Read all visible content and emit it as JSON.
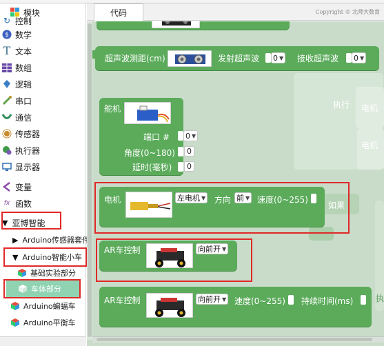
{
  "window": {
    "cut_title": "…"
  },
  "tabs": [
    {
      "label": "代码"
    }
  ],
  "copyright": "Copyright © 北师大数育",
  "sidebar": {
    "top_item": "模块",
    "categories": [
      {
        "label": "控制",
        "icon": "repeat-icon"
      },
      {
        "label": "数学",
        "icon": "math-icon"
      },
      {
        "label": "文本",
        "icon": "text-icon"
      },
      {
        "label": "数组",
        "icon": "array-icon"
      },
      {
        "label": "逻辑",
        "icon": "logic-icon"
      },
      {
        "label": "串口",
        "icon": "serial-icon"
      },
      {
        "label": "通信",
        "icon": "communication-icon"
      },
      {
        "label": "传感器",
        "icon": "sensor-icon"
      },
      {
        "label": "执行器",
        "icon": "actuator-icon"
      },
      {
        "label": "显示器",
        "icon": "display-icon"
      },
      {
        "label": "变量",
        "icon": "variable-icon"
      },
      {
        "label": "函数",
        "icon": "function-icon"
      }
    ],
    "group": "亚博智能",
    "subgroups": [
      {
        "label": "Arduino传感器套件",
        "expanded": false
      },
      {
        "label": "Arduino智能小车",
        "expanded": true
      }
    ],
    "kit_items": [
      {
        "label": "基础实验部分",
        "selected": false
      },
      {
        "label": "车体部分",
        "selected": true
      },
      {
        "label": "Arduino蝙蝠车",
        "selected": false
      },
      {
        "label": "Arduino平衡车",
        "selected": false
      }
    ]
  },
  "workspace": {
    "ghost_labels": [
      "执行",
      "电机",
      "电机",
      "如果",
      "执"
    ],
    "blocks": {
      "ultrasonic": {
        "label": "超声波测距(cm)",
        "trig_label": "发射超声波",
        "trig_value": "0",
        "echo_label": "接收超声波",
        "echo_value": "0"
      },
      "servo": {
        "label": "舵机",
        "port_label": "端口 #",
        "port_value": "0",
        "angle_label": "角度(0~180)",
        "angle_value": "0",
        "delay_label": "延时(毫秒)",
        "delay_value": "0"
      },
      "motor": {
        "label": "电机",
        "motor_select": "左电机",
        "direction_label": "方向",
        "direction_value": "前",
        "speed_label": "速度(0~255)"
      },
      "car_control": {
        "label": "AR车控制",
        "action": "向前开"
      },
      "car_control_timed": {
        "label": "AR车控制",
        "action": "向前开",
        "speed_label": "速度(0~255)",
        "duration_label": "持续时间(ms)"
      }
    }
  },
  "colors": {
    "block": "#5bab5b",
    "workspace": "#c9dcc9",
    "highlight": "#e02828",
    "selected": "#8fd3b3"
  }
}
